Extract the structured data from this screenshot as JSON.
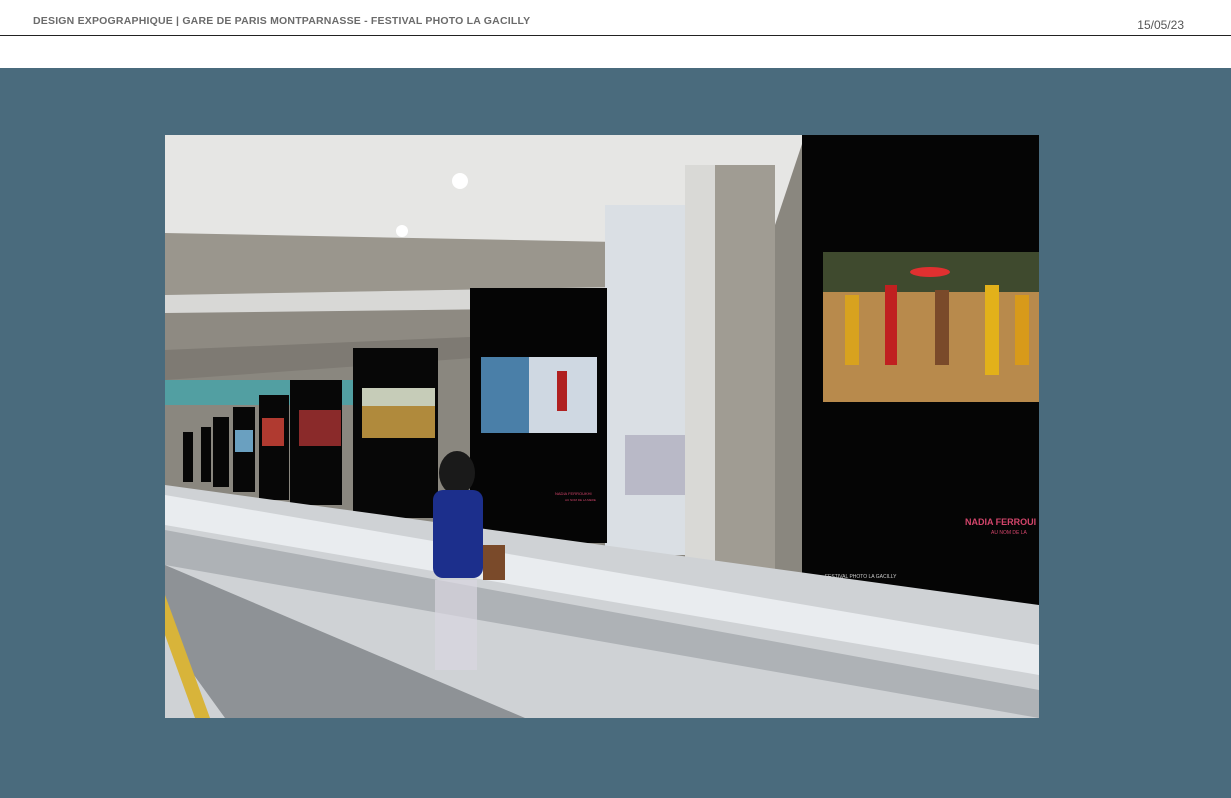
{
  "header": {
    "title": "DESIGN EXPOGRAPHIQUE | GARE DE PARIS MONTPARNASSE - FESTIVAL PHOTO LA GACILLY",
    "date": "15/05/23"
  },
  "colors": {
    "stage_background": "#4a6b7d",
    "header_text": "#6b6b6b"
  },
  "photo": {
    "panel_captions": {
      "large_panel_artist": "NADIA FERROUI",
      "large_panel_subtitle": "AU NOM DE LA",
      "large_panel_festival": "FESTIVAL PHOTO LA GACILLY",
      "mid_panel_artist": "NADIA FERROUKHI",
      "mid_panel_subtitle": "AU NOM DE LA MERE"
    }
  }
}
